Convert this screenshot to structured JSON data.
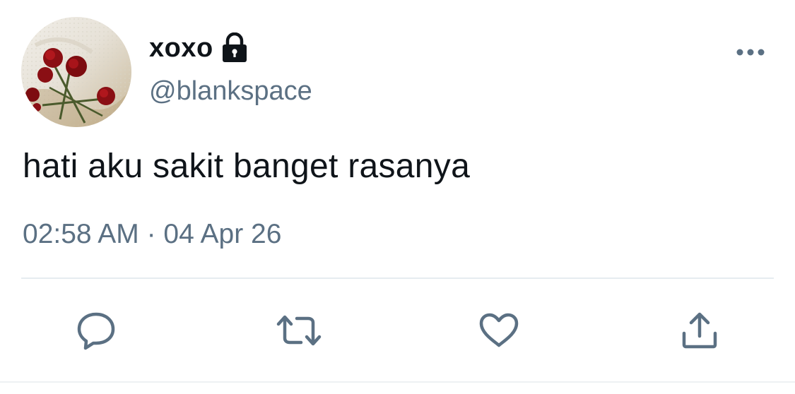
{
  "tweet": {
    "display_name": "xoxo",
    "handle": "@blankspace",
    "text": "hati aku sakit banget rasanya",
    "timestamp": "02:58 AM · 04 Apr 26"
  },
  "icons": {
    "lock": "lock-icon",
    "more": "more-horizontal-icon",
    "reply": "reply-icon",
    "retweet": "retweet-icon",
    "like": "heart-icon",
    "share": "share-icon"
  },
  "colors": {
    "text_primary": "#0f1419",
    "text_secondary": "#5b7083",
    "icon": "#5b7083",
    "divider": "#e6ecf0"
  }
}
